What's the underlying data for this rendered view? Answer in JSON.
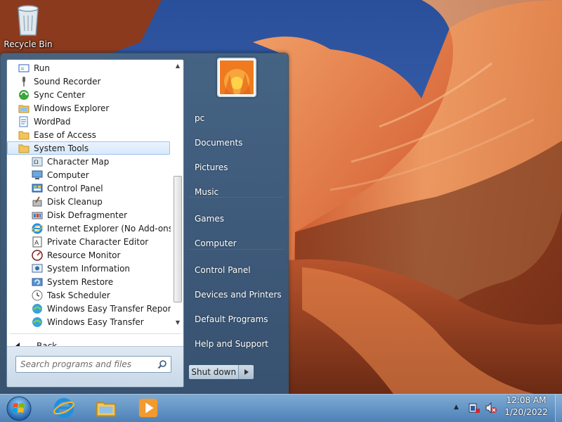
{
  "desktop": {
    "recycle_bin_label": "Recycle Bin"
  },
  "start_menu": {
    "programs": [
      {
        "label": "Run",
        "icon": "run-icon",
        "level": 0
      },
      {
        "label": "Sound Recorder",
        "icon": "microphone-icon",
        "level": 0
      },
      {
        "label": "Sync Center",
        "icon": "sync-icon",
        "level": 0
      },
      {
        "label": "Windows Explorer",
        "icon": "folder-explorer-icon",
        "level": 0
      },
      {
        "label": "WordPad",
        "icon": "wordpad-icon",
        "level": 0
      },
      {
        "label": "Ease of Access",
        "icon": "folder-icon",
        "level": 0
      },
      {
        "label": "System Tools",
        "icon": "folder-icon",
        "level": 0,
        "selected": true
      },
      {
        "label": "Character Map",
        "icon": "character-map-icon",
        "level": 1
      },
      {
        "label": "Computer",
        "icon": "computer-icon",
        "level": 1
      },
      {
        "label": "Control Panel",
        "icon": "control-panel-icon",
        "level": 1
      },
      {
        "label": "Disk Cleanup",
        "icon": "disk-cleanup-icon",
        "level": 1
      },
      {
        "label": "Disk Defragmenter",
        "icon": "disk-defragmenter-icon",
        "level": 1
      },
      {
        "label": "Internet Explorer (No Add-ons)",
        "icon": "internet-explorer-icon",
        "level": 1
      },
      {
        "label": "Private Character Editor",
        "icon": "character-editor-icon",
        "level": 1
      },
      {
        "label": "Resource Monitor",
        "icon": "resource-monitor-icon",
        "level": 1
      },
      {
        "label": "System Information",
        "icon": "system-information-icon",
        "level": 1
      },
      {
        "label": "System Restore",
        "icon": "system-restore-icon",
        "level": 1
      },
      {
        "label": "Task Scheduler",
        "icon": "clock-icon",
        "level": 1
      },
      {
        "label": "Windows Easy Transfer Reports",
        "icon": "easy-transfer-icon",
        "level": 1
      },
      {
        "label": "Windows Easy Transfer",
        "icon": "easy-transfer-icon",
        "level": 1
      }
    ],
    "back_label": "Back",
    "search_placeholder": "Search programs and files",
    "right_links": [
      {
        "label": "pc",
        "name": "user-folder"
      },
      {
        "label": "Documents",
        "name": "documents"
      },
      {
        "label": "Pictures",
        "name": "pictures"
      },
      {
        "label": "Music",
        "name": "music"
      },
      {
        "label": "Games",
        "name": "games"
      },
      {
        "label": "Computer",
        "name": "computer"
      },
      {
        "label": "Control Panel",
        "name": "control-panel"
      },
      {
        "label": "Devices and Printers",
        "name": "devices-and-printers"
      },
      {
        "label": "Default Programs",
        "name": "default-programs"
      },
      {
        "label": "Help and Support",
        "name": "help-and-support"
      }
    ],
    "shutdown_label": "Shut down"
  },
  "taskbar": {
    "pinned": [
      {
        "name": "internet-explorer",
        "icon": "internet-explorer-icon"
      },
      {
        "name": "windows-explorer",
        "icon": "folder-explorer-icon"
      },
      {
        "name": "media-player",
        "icon": "media-player-icon"
      }
    ],
    "clock": {
      "time": "12:08 AM",
      "date": "1/20/2022"
    }
  },
  "colors": {
    "selection_border": "#9ec5ef",
    "menu_frame": "#46647f"
  }
}
